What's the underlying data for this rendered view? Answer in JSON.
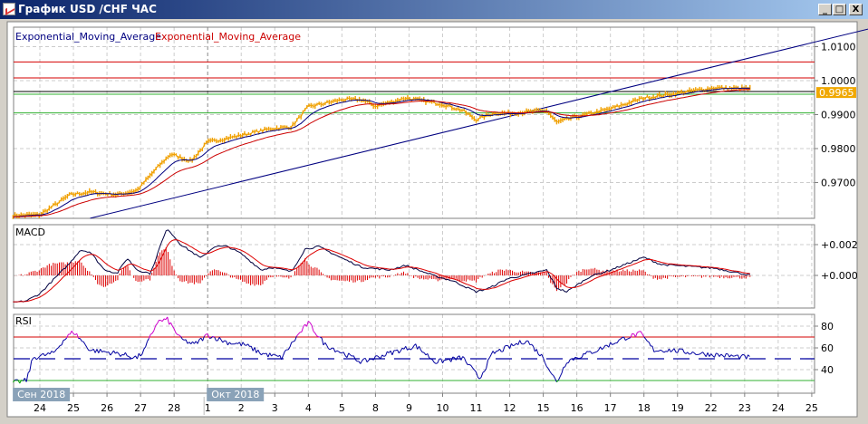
{
  "window": {
    "title": "График USD /CHF  ЧАС",
    "minimize": "_",
    "maximize": "□",
    "close": "X"
  },
  "legend": {
    "ema_fast": "Exponential_Moving_Average",
    "ema_slow": "Exponential_Moving_Average"
  },
  "colors": {
    "price": "#f0a000",
    "ema_fast": "#000080",
    "ema_slow": "#cc0000",
    "level_red": "#d40000",
    "level_green": "#30b030",
    "rsi": "#0000a0",
    "rsi_high": "#cc00cc",
    "rsi_low": "#00a000",
    "macd": "#000040",
    "signal": "#dd0000",
    "hist": "#dd0000",
    "date_badge": "#8aa2b8"
  },
  "panels": {
    "macd_label": "MACD",
    "rsi_label": "RSI"
  },
  "date_badges": [
    {
      "label": "Сен 2018",
      "day": -0.78
    },
    {
      "label": "Окт 2018",
      "day": 5.0
    }
  ],
  "chart_data": [
    {
      "type": "line",
      "title": "USD/CHF H1",
      "x_ticks": [
        "24",
        "25",
        "26",
        "27",
        "28",
        "1",
        "2",
        "3",
        "4",
        "5",
        "8",
        "9",
        "10",
        "11",
        "12",
        "15",
        "16",
        "17",
        "18",
        "19",
        "22",
        "23",
        "24",
        "25"
      ],
      "y_ticks": [
        "1.0100",
        "1.0000",
        "0.9900",
        "0.9800",
        "0.9700"
      ],
      "ylim": [
        0.9595,
        1.0157
      ],
      "current_price": "0.9965",
      "price_keypoints": [
        [
          -0.8,
          0.9603
        ],
        [
          0,
          0.9605
        ],
        [
          0.9,
          0.9664
        ],
        [
          1.5,
          0.9672
        ],
        [
          2.3,
          0.9664
        ],
        [
          2.9,
          0.9677
        ],
        [
          3.5,
          0.9744
        ],
        [
          3.9,
          0.9784
        ],
        [
          4.5,
          0.9763
        ],
        [
          5.0,
          0.9819
        ],
        [
          5.9,
          0.9837
        ],
        [
          6.9,
          0.9859
        ],
        [
          7.5,
          0.9864
        ],
        [
          8.0,
          0.9923
        ],
        [
          9.0,
          0.9944
        ],
        [
          9.6,
          0.9944
        ],
        [
          10.0,
          0.9925
        ],
        [
          10.9,
          0.9949
        ],
        [
          12.0,
          0.9931
        ],
        [
          12.6,
          0.9912
        ],
        [
          13.0,
          0.9885
        ],
        [
          13.5,
          0.9904
        ],
        [
          14.0,
          0.9904
        ],
        [
          15.1,
          0.9912
        ],
        [
          15.4,
          0.9877
        ],
        [
          15.9,
          0.9891
        ],
        [
          17.0,
          0.9917
        ],
        [
          18.0,
          0.9949
        ],
        [
          19.0,
          0.9963
        ],
        [
          20.1,
          0.9979
        ],
        [
          21.2,
          0.9976
        ]
      ],
      "levels": [
        {
          "value": 1.0055,
          "color": "red"
        },
        {
          "value": 1.0008,
          "color": "red"
        },
        {
          "value": 0.9968,
          "color": "black"
        },
        {
          "value": 0.996,
          "color": "green"
        },
        {
          "value": 0.9905,
          "color": "green"
        }
      ],
      "trendline": [
        [
          1.5,
          0.9595
        ],
        [
          24.9,
          1.0157
        ]
      ]
    },
    {
      "type": "line",
      "title": "MACD",
      "y_ticks": [
        "+0.002",
        "+0.000"
      ],
      "unit": 0.001,
      "macd_keypoints": [
        [
          -0.8,
          -1.76
        ],
        [
          -0.4,
          -1.65
        ],
        [
          0,
          -1.18
        ],
        [
          0.9,
          0.82
        ],
        [
          1.2,
          1.65
        ],
        [
          1.5,
          1.53
        ],
        [
          1.9,
          0.41
        ],
        [
          2.3,
          0.12
        ],
        [
          2.6,
          1.12
        ],
        [
          2.9,
          0.35
        ],
        [
          3.3,
          0.12
        ],
        [
          3.6,
          2.0
        ],
        [
          3.8,
          3.06
        ],
        [
          4.2,
          2.0
        ],
        [
          4.8,
          1.12
        ],
        [
          5.2,
          1.88
        ],
        [
          5.6,
          1.88
        ],
        [
          6.0,
          1.41
        ],
        [
          6.6,
          0.35
        ],
        [
          6.9,
          0.53
        ],
        [
          7.5,
          0.24
        ],
        [
          7.9,
          1.71
        ],
        [
          8.3,
          1.88
        ],
        [
          9.0,
          1.12
        ],
        [
          9.6,
          0.53
        ],
        [
          10.4,
          0.35
        ],
        [
          10.9,
          0.65
        ],
        [
          11.8,
          -0.06
        ],
        [
          12.3,
          -0.35
        ],
        [
          13.0,
          -1.06
        ],
        [
          13.4,
          -0.82
        ],
        [
          13.9,
          -0.24
        ],
        [
          15.1,
          0.35
        ],
        [
          15.4,
          -0.82
        ],
        [
          15.7,
          -1.06
        ],
        [
          16.4,
          -0.06
        ],
        [
          17.0,
          0.35
        ],
        [
          18.0,
          1.18
        ],
        [
          18.5,
          0.71
        ],
        [
          20.1,
          0.47
        ],
        [
          21.2,
          0.0
        ]
      ]
    },
    {
      "type": "line",
      "title": "RSI",
      "y_ticks": [
        "80",
        "60",
        "40"
      ],
      "levels": [
        70,
        50,
        30
      ],
      "rsi_keypoints": [
        [
          -0.8,
          28
        ],
        [
          -0.4,
          30
        ],
        [
          -0.2,
          51
        ],
        [
          0.4,
          55
        ],
        [
          0.7,
          67
        ],
        [
          1.0,
          75
        ],
        [
          1.5,
          58
        ],
        [
          2.3,
          55
        ],
        [
          2.9,
          51
        ],
        [
          3.1,
          57
        ],
        [
          3.5,
          84
        ],
        [
          3.8,
          86
        ],
        [
          4.2,
          68
        ],
        [
          4.6,
          63
        ],
        [
          5.0,
          72
        ],
        [
          5.6,
          65
        ],
        [
          6.1,
          63
        ],
        [
          6.6,
          55
        ],
        [
          7.2,
          51
        ],
        [
          7.7,
          72
        ],
        [
          8.0,
          83
        ],
        [
          8.5,
          63
        ],
        [
          9.6,
          47
        ],
        [
          10.4,
          55
        ],
        [
          11.2,
          62
        ],
        [
          11.8,
          47
        ],
        [
          12.6,
          51
        ],
        [
          13.1,
          32
        ],
        [
          13.5,
          55
        ],
        [
          14.5,
          67
        ],
        [
          15.0,
          51
        ],
        [
          15.4,
          28
        ],
        [
          15.7,
          48
        ],
        [
          16.6,
          58
        ],
        [
          17.5,
          70
        ],
        [
          17.9,
          73
        ],
        [
          18.3,
          58
        ],
        [
          18.8,
          58
        ],
        [
          19.6,
          55
        ],
        [
          20.4,
          53
        ],
        [
          21.2,
          51
        ]
      ]
    }
  ]
}
